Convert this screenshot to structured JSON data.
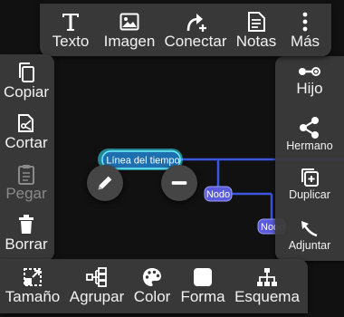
{
  "top_toolbar": {
    "texto": "Texto",
    "imagen": "Imagen",
    "conectar": "Conectar",
    "notas": "Notas",
    "mas": "Más"
  },
  "left_toolbar": {
    "copiar": "Copiar",
    "cortar": "Cortar",
    "pegar": "Pegar",
    "borrar": "Borrar"
  },
  "right_toolbar": {
    "hijo": "Hijo",
    "hermano": "Hermano",
    "duplicar": "Duplicar",
    "adjuntar": "Adjuntar"
  },
  "bottom_toolbar": {
    "tamano": "Tamaño",
    "agrupar": "Agrupar",
    "color": "Color",
    "forma": "Forma",
    "esquema": "Esquema"
  },
  "map": {
    "selected_node": "Línea del tiempo",
    "child_node_1": "Nodo",
    "child_node_2": "Nodo"
  },
  "colors": {
    "connector": "#3d55e0",
    "node_fill": "#5a5adc",
    "selected_fill": "#1e6fb0",
    "selected_glow": "#37e6ff"
  }
}
